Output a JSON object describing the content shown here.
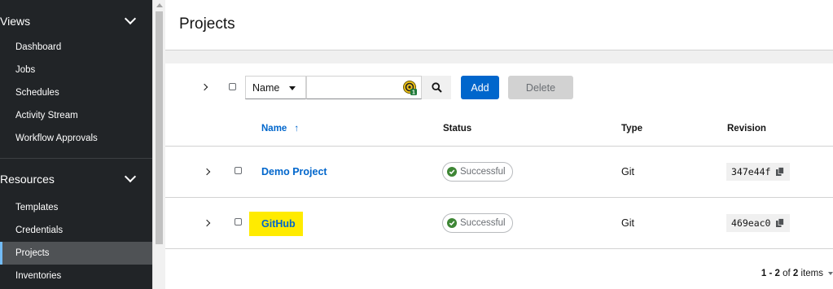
{
  "sidebar": {
    "views_label": "Views",
    "views_items": [
      {
        "label": "Dashboard"
      },
      {
        "label": "Jobs"
      },
      {
        "label": "Schedules"
      },
      {
        "label": "Activity Stream"
      },
      {
        "label": "Workflow Approvals"
      }
    ],
    "resources_label": "Resources",
    "resources_items": [
      {
        "label": "Templates"
      },
      {
        "label": "Credentials"
      },
      {
        "label": "Projects",
        "active": true
      },
      {
        "label": "Inventories"
      }
    ]
  },
  "header": {
    "title": "Projects"
  },
  "toolbar": {
    "filter_select": "Name",
    "search_value": "",
    "extension_badge": "1",
    "add_label": "Add",
    "delete_label": "Delete"
  },
  "table": {
    "columns": [
      "Name",
      "Status",
      "Type",
      "Revision"
    ],
    "sort_indicator": "↑",
    "rows": [
      {
        "name": "Demo Project",
        "status": "Successful",
        "type": "Git",
        "revision": "347e44f",
        "highlighted": false
      },
      {
        "name": "GitHub",
        "status": "Successful",
        "type": "Git",
        "revision": "469eac0",
        "highlighted": true
      }
    ]
  },
  "pagination": {
    "range": "1 - 2",
    "of": "of",
    "total": "2",
    "items": "items"
  },
  "colors": {
    "sidebar_bg": "#212427",
    "active_item_bg": "#4f5255",
    "link": "#0066cc",
    "success": "#3e8635",
    "highlight": "#ffeb00"
  }
}
